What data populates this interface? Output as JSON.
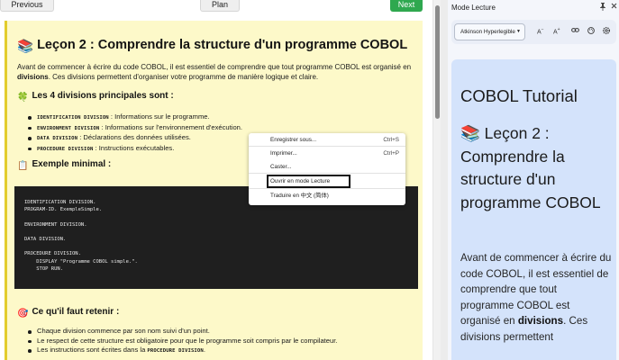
{
  "nav": {
    "previous": "Previous",
    "plan": "Plan",
    "next": "Next",
    "next_color": "#2fa84f"
  },
  "lesson": {
    "title_emoji": "📚",
    "title": "Leçon 2 : Comprendre la structure d'un programme COBOL",
    "intro_before": "Avant de commencer à écrire du code COBOL, il est essentiel de comprendre que tout programme COBOL est organisé en ",
    "intro_bold": "divisions",
    "intro_after": ". Ces divisions permettent d'organiser votre programme de manière logique et claire.",
    "divisions_emoji": "🍀",
    "divisions_heading": "Les 4 divisions principales sont :",
    "divisions": [
      {
        "keyword": "IDENTIFICATION DIVISION",
        "text": " : Informations sur le programme."
      },
      {
        "keyword": "ENVIRONMENT DIVISION",
        "text": " : Informations sur l'environnement d'exécution."
      },
      {
        "keyword": "DATA DIVISION",
        "text": " : Déclarations des données utilisées."
      },
      {
        "keyword": "PROCEDURE DIVISION",
        "text": " : Instructions exécutables."
      }
    ],
    "example_emoji": "📋",
    "example_heading": "Exemple minimal :",
    "code": "IDENTIFICATION DIVISION.\nPROGRAM-ID. ExempleSimple.\n\nENVIRONMENT DIVISION.\n\nDATA DIVISION.\n\nPROCEDURE DIVISION.\n    DISPLAY \"Programme COBOL simple.\".\n    STOP RUN.",
    "remember_emoji": "🎯",
    "remember_heading": "Ce qu'il faut retenir :",
    "remember": [
      "Chaque division commence par son nom suivi d'un point.",
      "Le respect de cette structure est obligatoire pour que le programme soit compris par le compilateur."
    ],
    "remember_last_text": "Les instructions sont écrites dans la ",
    "remember_last_keyword": "PROCEDURE DIVISION",
    "remember_last_end": "."
  },
  "context_menu": {
    "items": [
      {
        "label": "Enregistrer sous...",
        "shortcut": "Ctrl+S"
      },
      {
        "label": "Imprimer...",
        "shortcut": "Ctrl+P"
      },
      {
        "label": "Caster...",
        "shortcut": ""
      },
      {
        "label": "Ouvrir en mode Lecture",
        "shortcut": ""
      },
      {
        "label": "Traduire en 中文 (简体)",
        "shortcut": ""
      }
    ]
  },
  "reading_panel": {
    "title": "Mode Lecture",
    "font": "Atkinson Hyperlegible",
    "doc_title": "COBOL Tutorial",
    "heading_emoji": "📚",
    "heading": "Leçon 2 : Comprendre la structure d'un programme COBOL",
    "para_before": "Avant de commencer à écrire du code COBOL, il est essentiel de comprendre que tout programme COBOL est organisé en ",
    "para_bold": "divisions",
    "para_after": ". Ces divisions permettent",
    "bg_color": "#d4e3fb"
  }
}
